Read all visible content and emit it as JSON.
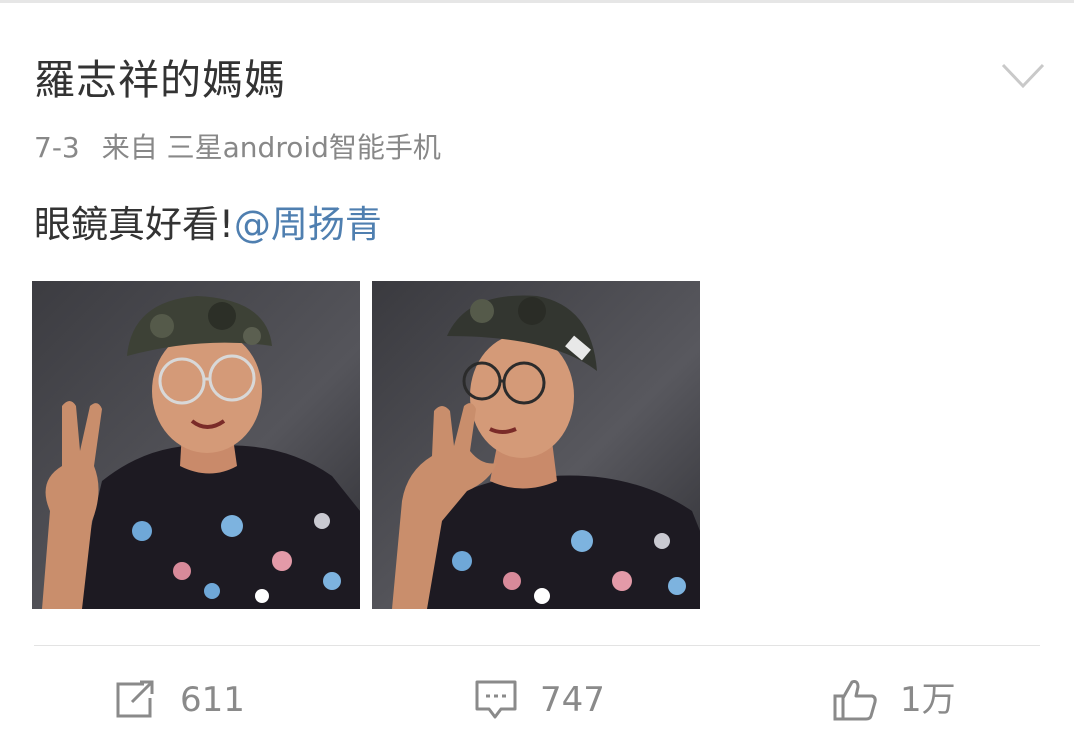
{
  "post": {
    "author": "羅志祥的媽媽",
    "date": "7-3",
    "source": "来自 三星android智能手机",
    "text": "眼鏡真好看!",
    "mention": "@周扬青"
  },
  "actions": {
    "repost_count": "611",
    "comment_count": "747",
    "like_count": "1万"
  },
  "colors": {
    "title": "#333333",
    "meta": "#888888",
    "mention_link": "#4f7fb0",
    "icon": "#8a8a8a"
  },
  "icons": [
    "chevron-down-icon",
    "repost-icon",
    "comment-icon",
    "like-icon"
  ]
}
